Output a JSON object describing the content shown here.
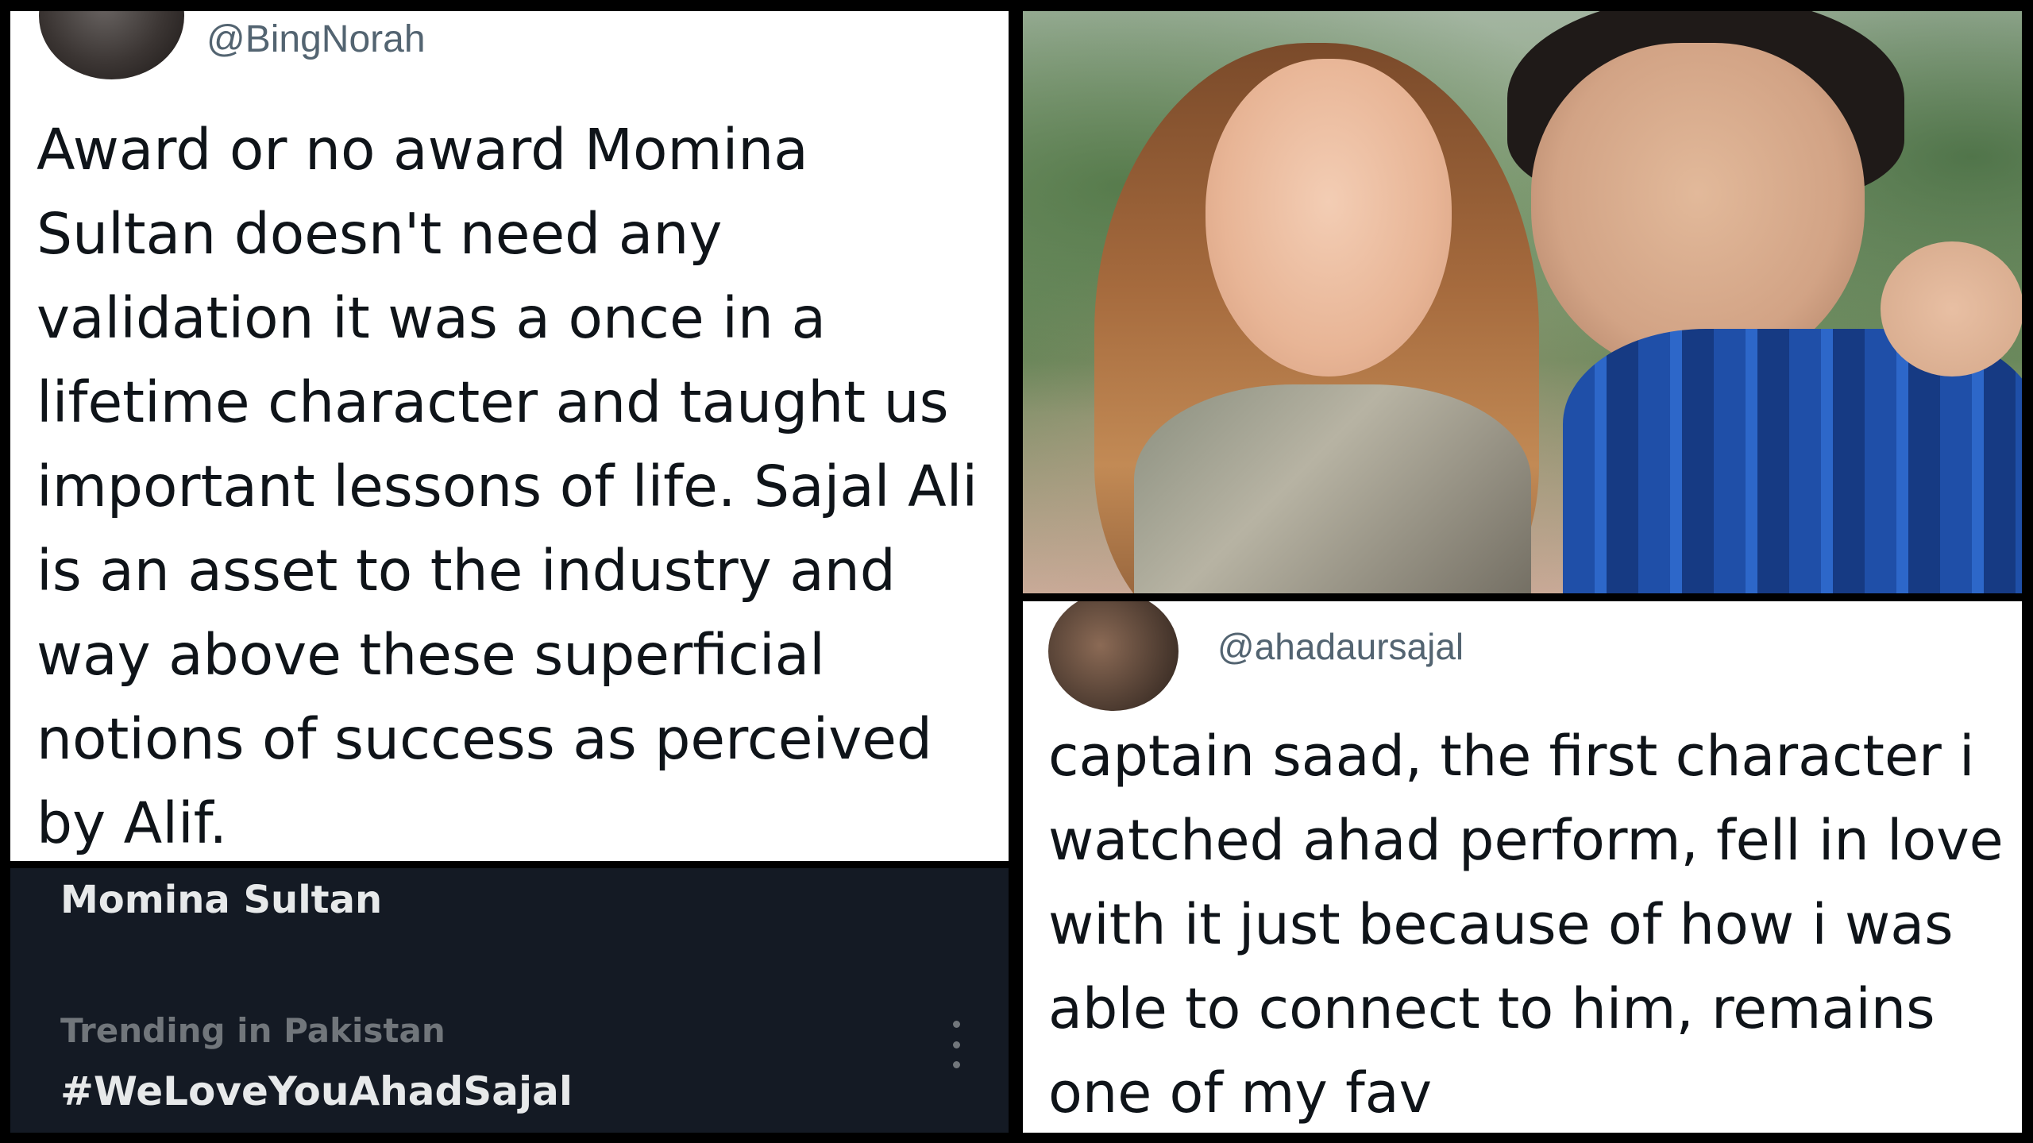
{
  "left_tweet": {
    "handle": "@BingNorah",
    "text": "Award or no award Momina Sultan doesn't need any validation it was a once in a lifetime character and taught us important lessons of life. Sajal Ali is an asset to the industry and way above these superficial notions of success as perceived by Alif."
  },
  "trending": {
    "topic_title": "Momina Sultan",
    "context": "Trending in Pakistan",
    "hashtag": "#WeLoveYouAhadSajal"
  },
  "right_tweet": {
    "handle": "@ahadaursajal",
    "text": "captain saad, the first character i watched ahad perform, fell in love with it just because of how i was able to connect to him, remains one of my fav"
  },
  "icons": {
    "more": "more-vertical-icon"
  },
  "colors": {
    "text_primary": "#0f1419",
    "text_secondary": "#536471",
    "trending_bg": "#141a24",
    "trending_text": "#e7e9ea",
    "trending_muted": "#71767b"
  }
}
